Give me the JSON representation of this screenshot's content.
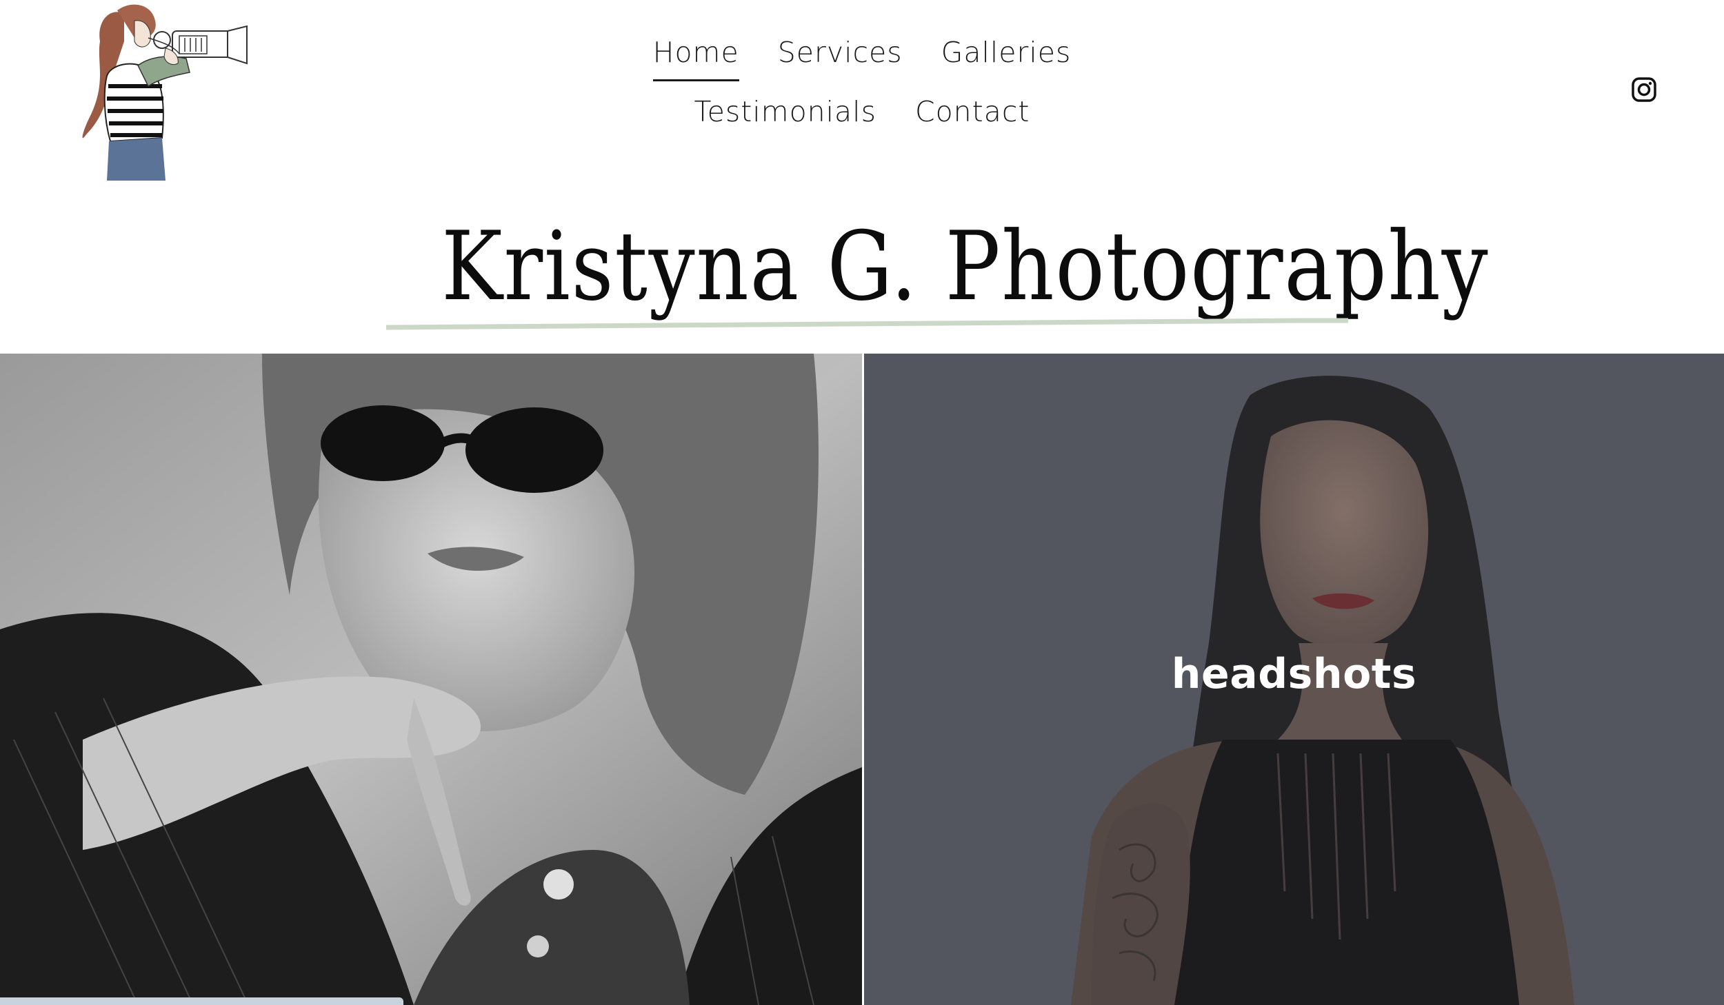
{
  "header": {
    "logo_icon": "photographer-illustration-icon",
    "nav": {
      "row1": [
        {
          "label": "Home",
          "active": true
        },
        {
          "label": "Services",
          "active": false
        },
        {
          "label": "Galleries",
          "active": false
        }
      ],
      "row2": [
        {
          "label": "Testimonials",
          "active": false
        },
        {
          "label": "Contact",
          "active": false
        }
      ]
    },
    "social_icon": "instagram-icon"
  },
  "hero": {
    "title": "Kristyna G. Photography",
    "underline_color": "#cbd8c8"
  },
  "gallery": {
    "tiles": [
      {
        "label": "",
        "photo": "black-and-white portrait with sunglasses"
      },
      {
        "label": "headshots",
        "photo": "color headshot portrait"
      }
    ]
  },
  "colors": {
    "background": "#ffffff",
    "text": "#111111",
    "accent": "#cbd8c8",
    "overlay": "#5b5e66"
  }
}
